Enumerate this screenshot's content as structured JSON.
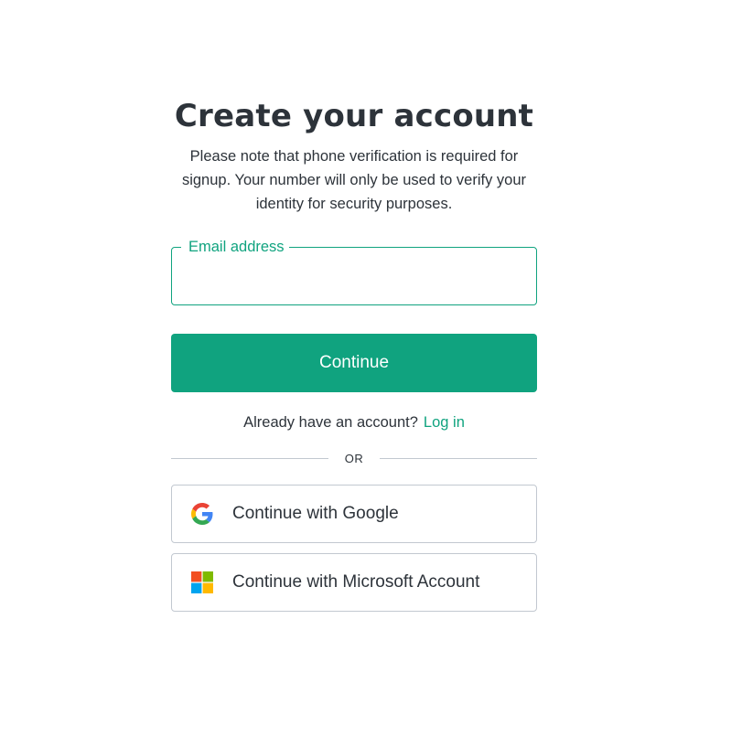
{
  "signup": {
    "title": "Create your account",
    "subtitle": "Please note that phone verification is required for signup. Your number will only be used to verify your identity for security purposes.",
    "email": {
      "label": "Email address",
      "value": "",
      "placeholder": ""
    },
    "continue_label": "Continue",
    "login_prompt": "Already have an account?",
    "login_link": "Log in",
    "divider_text": "OR",
    "google_label": "Continue with Google",
    "microsoft_label": "Continue with Microsoft Account"
  },
  "icons": {
    "google": "google-icon",
    "microsoft": "microsoft-icon"
  },
  "colors": {
    "accent": "#10a37f",
    "text": "#2d333a",
    "border": "#c2c8d0",
    "google_blue": "#4285F4",
    "google_green": "#34A853",
    "google_yellow": "#FBBC05",
    "google_red": "#EA4335",
    "ms_red": "#F25022",
    "ms_green": "#7FBA00",
    "ms_blue": "#00A4EF",
    "ms_yellow": "#FFB900"
  }
}
